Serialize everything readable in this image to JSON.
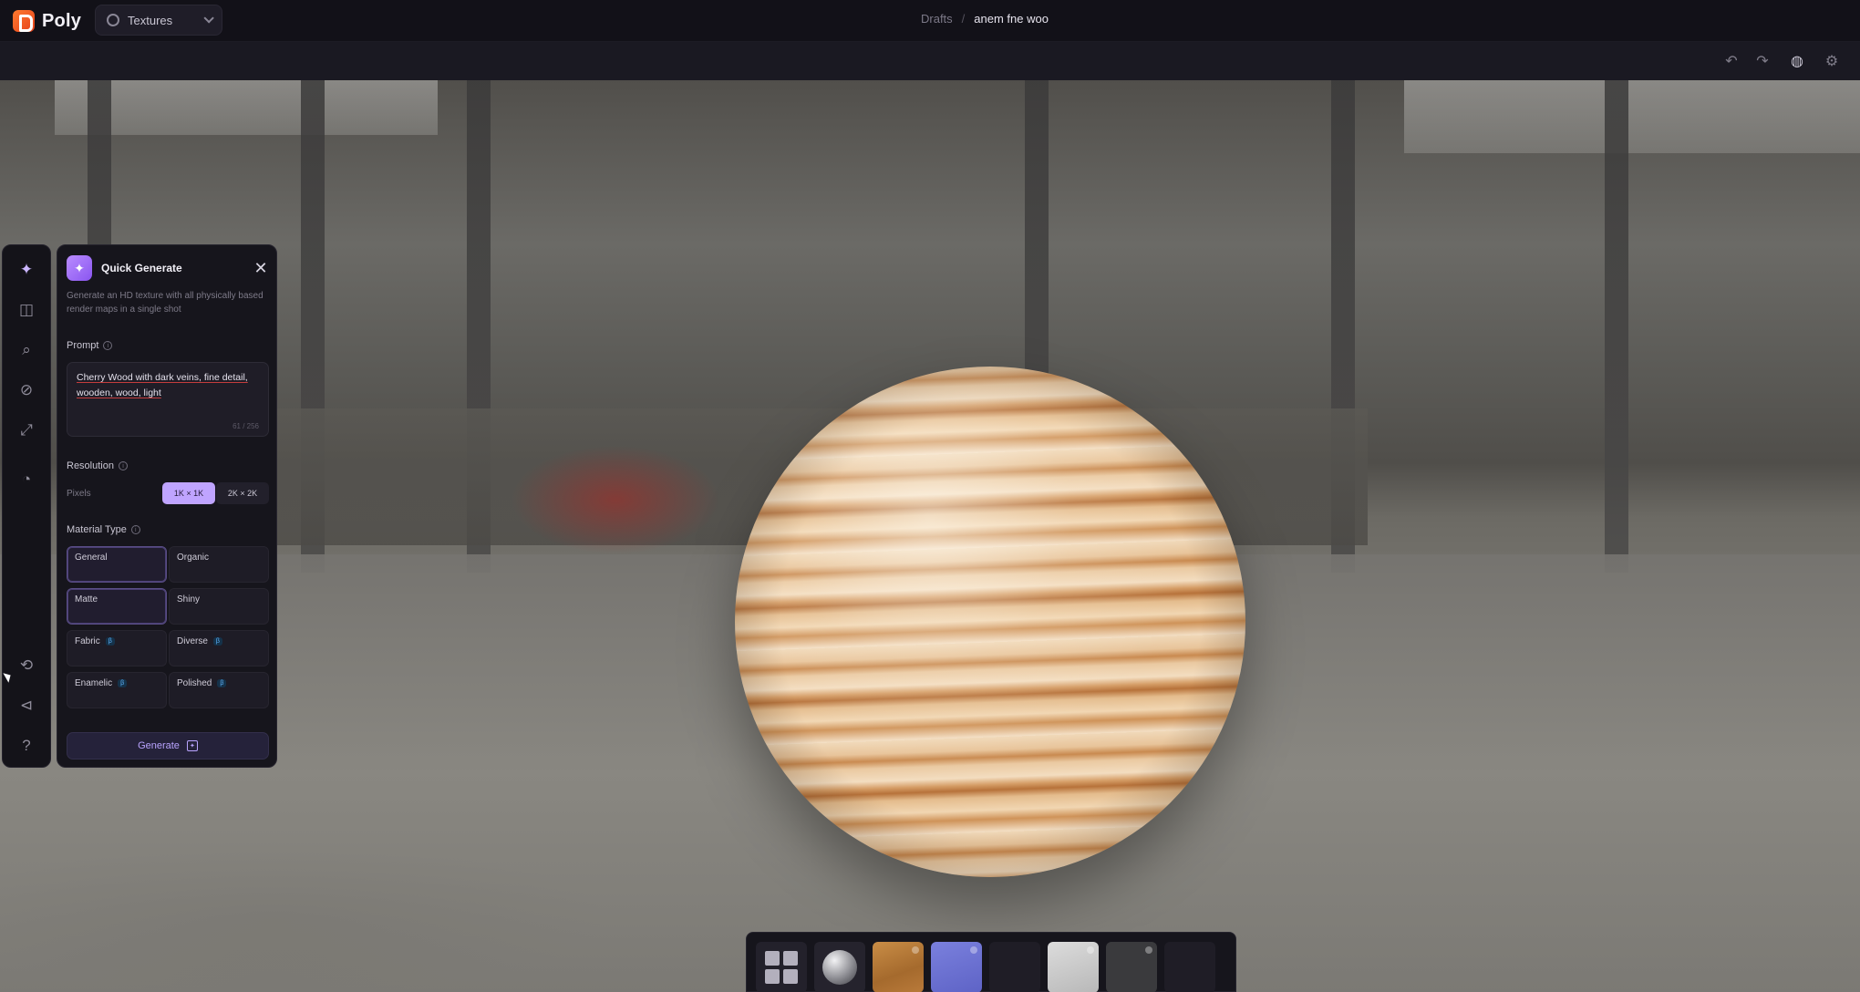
{
  "app": {
    "brand": "Poly",
    "section_select": "Textures"
  },
  "breadcrumb": {
    "parent": "Drafts",
    "separator": "/",
    "current": "anem fne woo"
  },
  "toolbar": {
    "undo_icon": "undo-icon",
    "redo_icon": "redo-icon",
    "environment_icon": "environment-icon",
    "settings_icon": "settings-icon"
  },
  "rail": {
    "items": [
      {
        "name": "magic-wand-icon",
        "glyph": "✦"
      },
      {
        "name": "layers-icon",
        "glyph": "◫"
      },
      {
        "name": "image-search-icon",
        "glyph": "⌕"
      },
      {
        "name": "link-icon",
        "glyph": "⊘"
      },
      {
        "name": "expand-icon",
        "glyph": "⤢"
      },
      {
        "name": "palette-icon",
        "glyph": "◔"
      },
      {
        "name": "history-icon",
        "glyph": "⟲"
      },
      {
        "name": "megaphone-icon",
        "glyph": "⊲"
      },
      {
        "name": "help-icon",
        "glyph": "?"
      }
    ]
  },
  "panel": {
    "title": "Quick Generate",
    "description": "Generate an HD texture with all physically based render maps in a single shot",
    "prompt_label": "Prompt",
    "prompt_value": "Cherry Wood with dark veins, fine detail, wooden, wood, light",
    "prompt_count": "61 / 256",
    "resolution_label": "Resolution",
    "pixels_label": "Pixels",
    "resolution_options": [
      "1K × 1K",
      "2K × 2K"
    ],
    "resolution_selected": "1K × 1K",
    "material_type_label": "Material Type",
    "material_types": [
      {
        "label": "General",
        "badge": "",
        "selected": true
      },
      {
        "label": "Organic",
        "badge": "",
        "selected": false
      },
      {
        "label": "Matte",
        "badge": "",
        "selected": true
      },
      {
        "label": "Shiny",
        "badge": "",
        "selected": false
      },
      {
        "label": "Fabric",
        "badge": "β",
        "selected": false
      },
      {
        "label": "Diverse",
        "badge": "β",
        "selected": false
      },
      {
        "label": "Enamelic",
        "badge": "β",
        "selected": false
      },
      {
        "label": "Polished",
        "badge": "β",
        "selected": false
      }
    ],
    "generate_label": "Generate",
    "close_icon": "close-icon"
  },
  "tray": {
    "slots": [
      {
        "name": "grid-view-icon",
        "kind": "grid"
      },
      {
        "name": "preview-sphere",
        "kind": "sphere"
      },
      {
        "name": "material-wood",
        "kind": "wood"
      },
      {
        "name": "material-purple",
        "kind": "purple"
      },
      {
        "name": "material-empty",
        "kind": "empty"
      },
      {
        "name": "material-white",
        "kind": "white"
      },
      {
        "name": "material-dark",
        "kind": "dark"
      },
      {
        "name": "material-empty",
        "kind": "empty"
      }
    ]
  },
  "colors": {
    "accent": "#bfa4ff",
    "panel_bg": "#16151c",
    "brand_orange": "#ff7a2e"
  }
}
